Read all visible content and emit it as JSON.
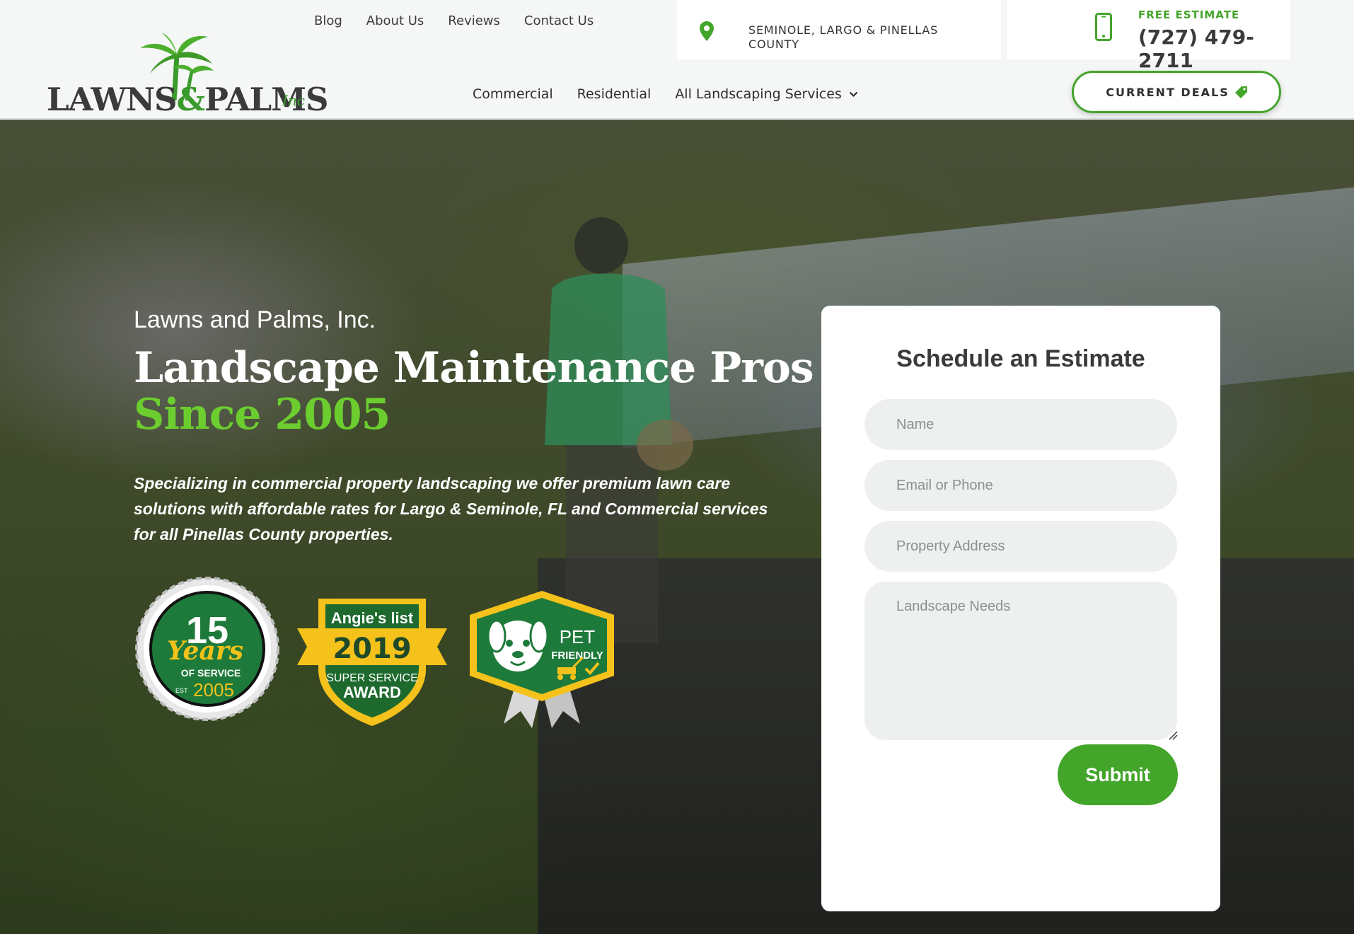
{
  "brand": {
    "logo_main": "LAWNS",
    "logo_amp": "&",
    "logo_second": "PALMS",
    "logo_suffix": "Inc"
  },
  "top_nav": [
    {
      "label": "Blog"
    },
    {
      "label": "About Us"
    },
    {
      "label": "Reviews"
    },
    {
      "label": "Contact Us"
    }
  ],
  "location": {
    "line1": "SEMINOLE, LARGO & PINELLAS",
    "line2": "COUNTY",
    "icon": "map-pin-icon"
  },
  "estimate": {
    "label": "FREE ESTIMATE",
    "phone": "(727) 479-2711",
    "icon": "mobile-phone-icon"
  },
  "main_nav": [
    {
      "label": "Commercial"
    },
    {
      "label": "Residential"
    },
    {
      "label": "All Landscaping Services"
    }
  ],
  "deals": {
    "label": "CURRENT DEALS",
    "icon": "tag-icon"
  },
  "hero": {
    "eyebrow": "Lawns and Palms, Inc.",
    "headline_line1": "Landscape Maintenance Pros",
    "headline_line2": "Since 2005",
    "lede": "Specializing in commercial property landscaping we offer premium lawn care solutions with affordable rates for Largo & Seminole, FL and Commercial services for all Pinellas County properties."
  },
  "badges": {
    "years": {
      "number": "15",
      "script": "Years",
      "sub": "OF SERVICE",
      "est": "EST",
      "year": "2005"
    },
    "angie": {
      "brand": "Angie's list",
      "year": "2019",
      "line1": "SUPER SERVICE",
      "line2": "AWARD"
    },
    "pet": {
      "line1": "PET",
      "line2": "FRIENDLY"
    }
  },
  "form": {
    "title": "Schedule an Estimate",
    "name_placeholder": "Name",
    "contact_placeholder": "Email or Phone",
    "address_placeholder": "Property Address",
    "needs_placeholder": "Landscape Needs",
    "submit_label": "Submit"
  },
  "colors": {
    "brand_green": "#44a52b",
    "headline_green": "#6ccd2f",
    "text_dark": "#3b3b3b",
    "field_bg": "#eef0f0"
  }
}
